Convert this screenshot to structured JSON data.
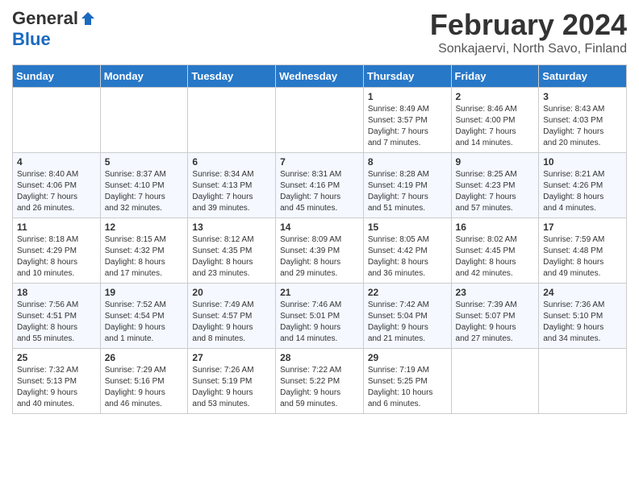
{
  "header": {
    "logo_general": "General",
    "logo_blue": "Blue",
    "title": "February 2024",
    "location": "Sonkajaervi, North Savo, Finland"
  },
  "days_of_week": [
    "Sunday",
    "Monday",
    "Tuesday",
    "Wednesday",
    "Thursday",
    "Friday",
    "Saturday"
  ],
  "weeks": [
    [
      {
        "day": "",
        "info": ""
      },
      {
        "day": "",
        "info": ""
      },
      {
        "day": "",
        "info": ""
      },
      {
        "day": "",
        "info": ""
      },
      {
        "day": "1",
        "info": "Sunrise: 8:49 AM\nSunset: 3:57 PM\nDaylight: 7 hours\nand 7 minutes."
      },
      {
        "day": "2",
        "info": "Sunrise: 8:46 AM\nSunset: 4:00 PM\nDaylight: 7 hours\nand 14 minutes."
      },
      {
        "day": "3",
        "info": "Sunrise: 8:43 AM\nSunset: 4:03 PM\nDaylight: 7 hours\nand 20 minutes."
      }
    ],
    [
      {
        "day": "4",
        "info": "Sunrise: 8:40 AM\nSunset: 4:06 PM\nDaylight: 7 hours\nand 26 minutes."
      },
      {
        "day": "5",
        "info": "Sunrise: 8:37 AM\nSunset: 4:10 PM\nDaylight: 7 hours\nand 32 minutes."
      },
      {
        "day": "6",
        "info": "Sunrise: 8:34 AM\nSunset: 4:13 PM\nDaylight: 7 hours\nand 39 minutes."
      },
      {
        "day": "7",
        "info": "Sunrise: 8:31 AM\nSunset: 4:16 PM\nDaylight: 7 hours\nand 45 minutes."
      },
      {
        "day": "8",
        "info": "Sunrise: 8:28 AM\nSunset: 4:19 PM\nDaylight: 7 hours\nand 51 minutes."
      },
      {
        "day": "9",
        "info": "Sunrise: 8:25 AM\nSunset: 4:23 PM\nDaylight: 7 hours\nand 57 minutes."
      },
      {
        "day": "10",
        "info": "Sunrise: 8:21 AM\nSunset: 4:26 PM\nDaylight: 8 hours\nand 4 minutes."
      }
    ],
    [
      {
        "day": "11",
        "info": "Sunrise: 8:18 AM\nSunset: 4:29 PM\nDaylight: 8 hours\nand 10 minutes."
      },
      {
        "day": "12",
        "info": "Sunrise: 8:15 AM\nSunset: 4:32 PM\nDaylight: 8 hours\nand 17 minutes."
      },
      {
        "day": "13",
        "info": "Sunrise: 8:12 AM\nSunset: 4:35 PM\nDaylight: 8 hours\nand 23 minutes."
      },
      {
        "day": "14",
        "info": "Sunrise: 8:09 AM\nSunset: 4:39 PM\nDaylight: 8 hours\nand 29 minutes."
      },
      {
        "day": "15",
        "info": "Sunrise: 8:05 AM\nSunset: 4:42 PM\nDaylight: 8 hours\nand 36 minutes."
      },
      {
        "day": "16",
        "info": "Sunrise: 8:02 AM\nSunset: 4:45 PM\nDaylight: 8 hours\nand 42 minutes."
      },
      {
        "day": "17",
        "info": "Sunrise: 7:59 AM\nSunset: 4:48 PM\nDaylight: 8 hours\nand 49 minutes."
      }
    ],
    [
      {
        "day": "18",
        "info": "Sunrise: 7:56 AM\nSunset: 4:51 PM\nDaylight: 8 hours\nand 55 minutes."
      },
      {
        "day": "19",
        "info": "Sunrise: 7:52 AM\nSunset: 4:54 PM\nDaylight: 9 hours\nand 1 minute."
      },
      {
        "day": "20",
        "info": "Sunrise: 7:49 AM\nSunset: 4:57 PM\nDaylight: 9 hours\nand 8 minutes."
      },
      {
        "day": "21",
        "info": "Sunrise: 7:46 AM\nSunset: 5:01 PM\nDaylight: 9 hours\nand 14 minutes."
      },
      {
        "day": "22",
        "info": "Sunrise: 7:42 AM\nSunset: 5:04 PM\nDaylight: 9 hours\nand 21 minutes."
      },
      {
        "day": "23",
        "info": "Sunrise: 7:39 AM\nSunset: 5:07 PM\nDaylight: 9 hours\nand 27 minutes."
      },
      {
        "day": "24",
        "info": "Sunrise: 7:36 AM\nSunset: 5:10 PM\nDaylight: 9 hours\nand 34 minutes."
      }
    ],
    [
      {
        "day": "25",
        "info": "Sunrise: 7:32 AM\nSunset: 5:13 PM\nDaylight: 9 hours\nand 40 minutes."
      },
      {
        "day": "26",
        "info": "Sunrise: 7:29 AM\nSunset: 5:16 PM\nDaylight: 9 hours\nand 46 minutes."
      },
      {
        "day": "27",
        "info": "Sunrise: 7:26 AM\nSunset: 5:19 PM\nDaylight: 9 hours\nand 53 minutes."
      },
      {
        "day": "28",
        "info": "Sunrise: 7:22 AM\nSunset: 5:22 PM\nDaylight: 9 hours\nand 59 minutes."
      },
      {
        "day": "29",
        "info": "Sunrise: 7:19 AM\nSunset: 5:25 PM\nDaylight: 10 hours\nand 6 minutes."
      },
      {
        "day": "",
        "info": ""
      },
      {
        "day": "",
        "info": ""
      }
    ]
  ]
}
